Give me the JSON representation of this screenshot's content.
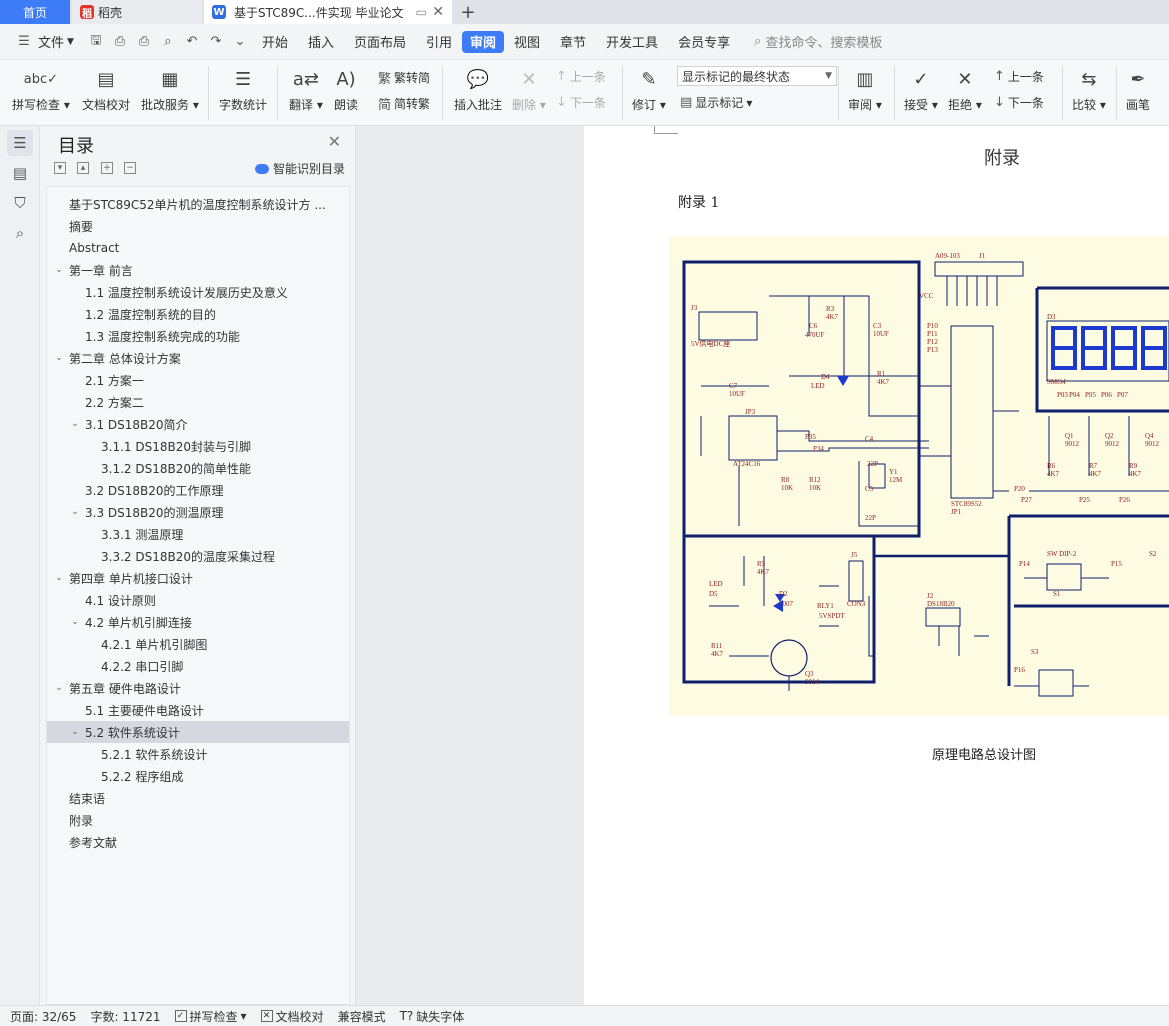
{
  "tabs": {
    "home": "首页",
    "shell": "稻壳",
    "doc": "基于STC89C...件实现 毕业论文"
  },
  "menu": {
    "file": "文件",
    "items": [
      "开始",
      "插入",
      "页面布局",
      "引用",
      "审阅",
      "视图",
      "章节",
      "开发工具",
      "会员专享"
    ],
    "active": "审阅",
    "search": "查找命令、搜索模板"
  },
  "ribbon": {
    "spell": "拼写检查",
    "proof": "文档校对",
    "batch": "批改服务",
    "wordcount": "字数统计",
    "translate": "翻译",
    "read": "朗读",
    "trad2simp": "繁转简",
    "simp2trad": "简转繁",
    "insert_comment": "插入批注",
    "delete": "删除",
    "prev": "上一条",
    "next": "下一条",
    "markup_state": "显示标记的最终状态",
    "revise": "修订",
    "show_markup": "显示标记",
    "review": "审阅",
    "accept": "接受",
    "reject": "拒绝",
    "prev2": "上一条",
    "next2": "下一条",
    "compare": "比较",
    "pen": "画笔"
  },
  "toc": {
    "title": "目录",
    "ai_label": "智能识别目录",
    "items": [
      {
        "text": "基于STC89C52单片机的温度控制系统设计方 ...",
        "level": 0,
        "chev": ""
      },
      {
        "text": "摘要",
        "level": 0,
        "chev": ""
      },
      {
        "text": "Abstract",
        "level": 0,
        "chev": ""
      },
      {
        "text": "第一章 前言",
        "level": 0,
        "chev": "v"
      },
      {
        "text": "1.1  温度控制系统设计发展历史及意义",
        "level": 1,
        "chev": ""
      },
      {
        "text": "1.2  温度控制系统的目的",
        "level": 1,
        "chev": ""
      },
      {
        "text": "1.3  温度控制系统完成的功能",
        "level": 1,
        "chev": ""
      },
      {
        "text": "第二章 总体设计方案",
        "level": 0,
        "chev": "v"
      },
      {
        "text": "2.1  方案一",
        "level": 1,
        "chev": ""
      },
      {
        "text": "2.2  方案二",
        "level": 1,
        "chev": ""
      },
      {
        "text": "3.1 DS18B20简介",
        "level": 1,
        "chev": "v"
      },
      {
        "text": "3.1.1 DS18B20封装与引脚",
        "level": 2,
        "chev": ""
      },
      {
        "text": "3.1.2 DS18B20的简单性能",
        "level": 2,
        "chev": ""
      },
      {
        "text": "3.2 DS18B20的工作原理",
        "level": 1,
        "chev": ""
      },
      {
        "text": "3.3 DS18B20的测温原理",
        "level": 1,
        "chev": "v"
      },
      {
        "text": "3.3.1  测温原理",
        "level": 2,
        "chev": ""
      },
      {
        "text": "3.3.2 DS18B20的温度采集过程",
        "level": 2,
        "chev": ""
      },
      {
        "text": "第四章 单片机接口设计",
        "level": 0,
        "chev": "v"
      },
      {
        "text": "4.1  设计原则",
        "level": 1,
        "chev": ""
      },
      {
        "text": "4.2  单片机引脚连接",
        "level": 1,
        "chev": "v"
      },
      {
        "text": "4.2.1  单片机引脚图",
        "level": 2,
        "chev": ""
      },
      {
        "text": "4.2.2  串口引脚",
        "level": 2,
        "chev": ""
      },
      {
        "text": "第五章 硬件电路设计",
        "level": 0,
        "chev": "v"
      },
      {
        "text": "5.1  主要硬件电路设计",
        "level": 1,
        "chev": ""
      },
      {
        "text": "5.2  软件系统设计",
        "level": 1,
        "chev": "v",
        "selected": true
      },
      {
        "text": "5.2.1  软件系统设计",
        "level": 2,
        "chev": ""
      },
      {
        "text": "5.2.2  程序组成",
        "level": 2,
        "chev": ""
      },
      {
        "text": "结束语",
        "level": 0,
        "chev": ""
      },
      {
        "text": "附录",
        "level": 0,
        "chev": ""
      },
      {
        "text": "参考文献",
        "level": 0,
        "chev": ""
      }
    ]
  },
  "page": {
    "heading": "附录",
    "subheading": "附录 1",
    "caption": "原理电路总设计图"
  },
  "schematic": {
    "labels": [
      "A09-103",
      "J1",
      "VCC",
      "P10",
      "P11",
      "P12",
      "P13",
      "J3",
      "5V供电DC座",
      "C6",
      "470UF",
      "R3",
      "4K7",
      "C3",
      "10UF",
      "D4",
      "LED",
      "R1",
      "4K7",
      "C7",
      "10UF",
      "JP3",
      "AT24C16",
      "P35",
      "P34",
      "R8",
      "10K",
      "R12",
      "10K",
      "C4",
      "22P",
      "Y1",
      "12M",
      "C5",
      "22P",
      "STC89S52",
      "JP1",
      "D3",
      "SMG4",
      "Q1",
      "9012",
      "Q2",
      "9012",
      "Q4",
      "9012",
      "R6",
      "4K7",
      "R7",
      "4K7",
      "R9",
      "4K7",
      "P27",
      "P25",
      "P26",
      "P20",
      "P03",
      "P04",
      "P05",
      "P06",
      "P07",
      "R5",
      "4K7",
      "LED",
      "D5",
      "D2",
      "4007",
      "J5",
      "CON3",
      "RLY1",
      "5VSPDT",
      "R11",
      "4K7",
      "Q3",
      "9014",
      "J2",
      "DS18B20",
      "SW DIP-2",
      "S1",
      "S2",
      "S3",
      "P14",
      "P15",
      "P16"
    ]
  },
  "status": {
    "page": "页面: 32/65",
    "words": "字数: 11721",
    "spell": "拼写检查",
    "proof": "文档校对",
    "compat": "兼容模式",
    "font": "缺失字体"
  }
}
